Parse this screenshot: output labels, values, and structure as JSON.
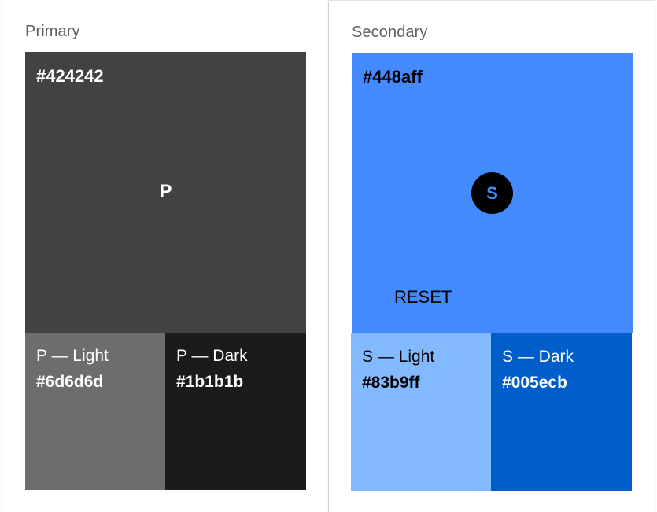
{
  "primary": {
    "title": "Primary",
    "main": {
      "hex": "#424242",
      "letter": "P",
      "color": "#424242",
      "text_color": "#ffffff"
    },
    "light": {
      "label": "P — Light",
      "hex": "#6d6d6d",
      "color": "#6d6d6d",
      "text_color": "#ffffff"
    },
    "dark": {
      "label": "P — Dark",
      "hex": "#1b1b1b",
      "color": "#1b1b1b",
      "text_color": "#ffffff"
    }
  },
  "secondary": {
    "title": "Secondary",
    "main": {
      "hex": "#448aff",
      "letter": "S",
      "color": "#448aff",
      "text_color": "#000000",
      "reset_label": "RESET"
    },
    "light": {
      "label": "S — Light",
      "hex": "#83b9ff",
      "color": "#83b9ff",
      "text_color": "#000000"
    },
    "dark": {
      "label": "S — Dark",
      "hex": "#005ecb",
      "color": "#005ecb",
      "text_color": "#ffffff"
    }
  }
}
